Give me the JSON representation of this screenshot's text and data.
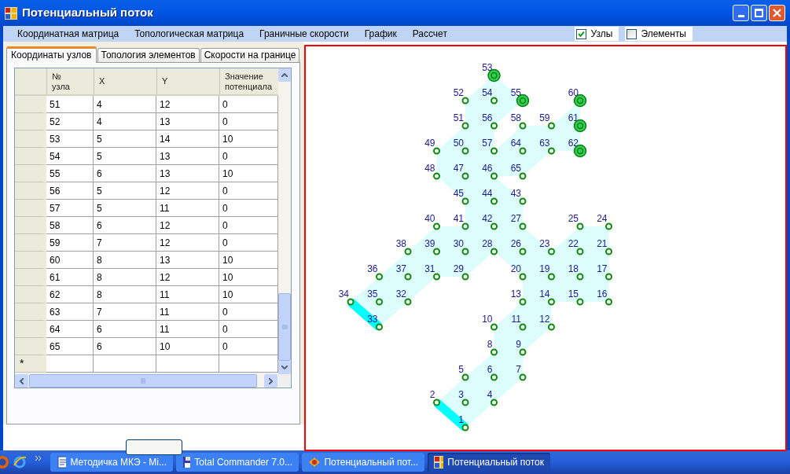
{
  "window": {
    "title": "Потенциальный поток"
  },
  "menu": [
    "Координатная матрица",
    "Топологическая матрица",
    "Граничные скорости",
    "График",
    "Рассчет"
  ],
  "toggles": [
    {
      "label": "Узлы",
      "checked": true
    },
    {
      "label": "Элементы",
      "checked": false
    }
  ],
  "tabs": [
    {
      "label": "Координаты узлов",
      "selected": true
    },
    {
      "label": "Топология элементов",
      "selected": false
    },
    {
      "label": "Скорости на границе",
      "selected": false
    }
  ],
  "table": {
    "columns": [
      "№ узла",
      "X",
      "Y",
      "Значение потенциала"
    ],
    "rows": [
      [
        "51",
        "4",
        "12",
        "0"
      ],
      [
        "52",
        "4",
        "13",
        "0"
      ],
      [
        "53",
        "5",
        "14",
        "10"
      ],
      [
        "54",
        "5",
        "13",
        "0"
      ],
      [
        "55",
        "6",
        "13",
        "10"
      ],
      [
        "56",
        "5",
        "12",
        "0"
      ],
      [
        "57",
        "5",
        "11",
        "0"
      ],
      [
        "58",
        "6",
        "12",
        "0"
      ],
      [
        "59",
        "7",
        "12",
        "0"
      ],
      [
        "60",
        "8",
        "13",
        "10"
      ],
      [
        "61",
        "8",
        "12",
        "10"
      ],
      [
        "62",
        "8",
        "11",
        "10"
      ],
      [
        "63",
        "7",
        "11",
        "0"
      ],
      [
        "64",
        "6",
        "11",
        "0"
      ],
      [
        "65",
        "6",
        "10",
        "0"
      ]
    ],
    "new_row_marker": "*"
  },
  "diagram": {
    "nodes": [
      {
        "label": "53",
        "kind": "fixed"
      },
      {
        "label": "52",
        "kind": "inner"
      },
      {
        "label": "54",
        "kind": "inner"
      },
      {
        "label": "55",
        "kind": "fixed"
      },
      {
        "label": "60",
        "kind": "fixed"
      },
      {
        "label": "51",
        "kind": "inner"
      },
      {
        "label": "56",
        "kind": "inner"
      },
      {
        "label": "58",
        "kind": "inner"
      },
      {
        "label": "59",
        "kind": "inner"
      },
      {
        "label": "61",
        "kind": "fixed"
      },
      {
        "label": "49",
        "kind": "inner"
      },
      {
        "label": "50",
        "kind": "inner"
      },
      {
        "label": "57",
        "kind": "inner"
      },
      {
        "label": "64",
        "kind": "inner"
      },
      {
        "label": "63",
        "kind": "inner"
      },
      {
        "label": "62",
        "kind": "fixed"
      },
      {
        "label": "48",
        "kind": "inner"
      },
      {
        "label": "47",
        "kind": "inner"
      },
      {
        "label": "46",
        "kind": "inner"
      },
      {
        "label": "65",
        "kind": "inner"
      },
      {
        "label": "45",
        "kind": "inner"
      },
      {
        "label": "44",
        "kind": "inner"
      },
      {
        "label": "43",
        "kind": "inner"
      },
      {
        "label": "40",
        "kind": "inner"
      },
      {
        "label": "41",
        "kind": "inner"
      },
      {
        "label": "42",
        "kind": "inner"
      },
      {
        "label": "27",
        "kind": "inner"
      },
      {
        "label": "25",
        "kind": "inner"
      },
      {
        "label": "24",
        "kind": "inner"
      },
      {
        "label": "38",
        "kind": "inner"
      },
      {
        "label": "39",
        "kind": "inner"
      },
      {
        "label": "30",
        "kind": "inner"
      },
      {
        "label": "28",
        "kind": "inner"
      },
      {
        "label": "26",
        "kind": "inner"
      },
      {
        "label": "23",
        "kind": "inner"
      },
      {
        "label": "22",
        "kind": "inner"
      },
      {
        "label": "21",
        "kind": "inner"
      },
      {
        "label": "36",
        "kind": "inner"
      },
      {
        "label": "37",
        "kind": "inner"
      },
      {
        "label": "31",
        "kind": "inner"
      },
      {
        "label": "29",
        "kind": "inner"
      },
      {
        "label": "20",
        "kind": "inner"
      },
      {
        "label": "19",
        "kind": "inner"
      },
      {
        "label": "18",
        "kind": "inner"
      },
      {
        "label": "17",
        "kind": "inner"
      },
      {
        "label": "34",
        "kind": "inlet"
      },
      {
        "label": "35",
        "kind": "inner"
      },
      {
        "label": "32",
        "kind": "inner"
      },
      {
        "label": "13",
        "kind": "inner"
      },
      {
        "label": "14",
        "kind": "inner"
      },
      {
        "label": "15",
        "kind": "inner"
      },
      {
        "label": "16",
        "kind": "inner"
      },
      {
        "label": "33",
        "kind": "inlet"
      },
      {
        "label": "10",
        "kind": "inner"
      },
      {
        "label": "11",
        "kind": "inner"
      },
      {
        "label": "12",
        "kind": "inner"
      },
      {
        "label": "8",
        "kind": "inner"
      },
      {
        "label": "9",
        "kind": "inner"
      },
      {
        "label": "5",
        "kind": "inner"
      },
      {
        "label": "6",
        "kind": "inner"
      },
      {
        "label": "7",
        "kind": "inner"
      },
      {
        "label": "2",
        "kind": "inlet"
      },
      {
        "label": "3",
        "kind": "inner"
      },
      {
        "label": "4",
        "kind": "inner"
      },
      {
        "label": "1",
        "kind": "inlet"
      }
    ]
  },
  "taskbar": {
    "items": [
      {
        "label": "Методичка МКЭ - Mi...",
        "kind": "document",
        "selected": false
      },
      {
        "label": "Total Commander 7.0...",
        "kind": "disk",
        "selected": false
      },
      {
        "label": "Потенциальный пот...",
        "kind": "program",
        "selected": false
      },
      {
        "label": "Потенциальный поток",
        "kind": "app",
        "selected": true
      }
    ]
  }
}
